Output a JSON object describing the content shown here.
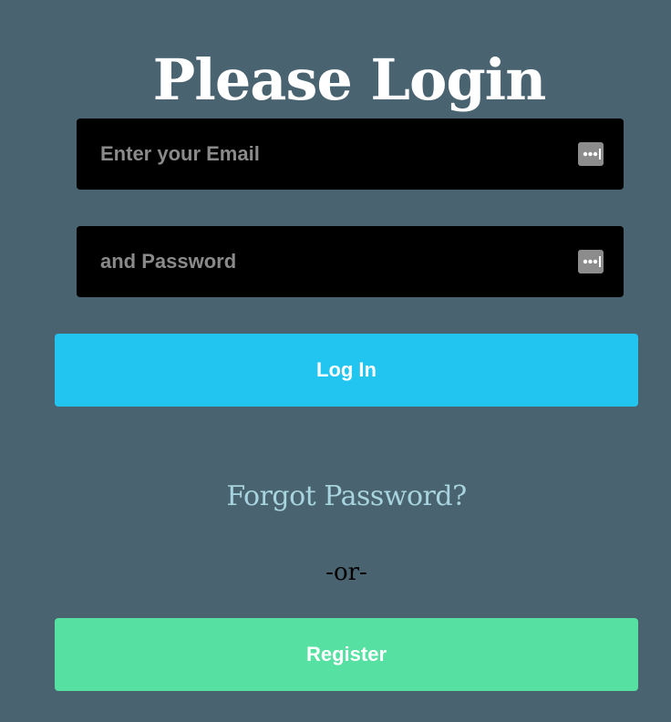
{
  "page": {
    "title": "Please Login"
  },
  "form": {
    "email": {
      "placeholder": "Enter your Email",
      "value": ""
    },
    "password": {
      "placeholder": "and Password",
      "value": ""
    },
    "field_icon": "password-manager-key-icon",
    "login_label": "Log In",
    "forgot_label": "Forgot Password?",
    "or_label": "-or-",
    "register_label": "Register"
  },
  "colors": {
    "background": "#4a6370",
    "field_background": "#000000",
    "login_button": "#22c4f0",
    "register_button": "#56e0a2",
    "forgot_link": "#a8d4e0"
  }
}
